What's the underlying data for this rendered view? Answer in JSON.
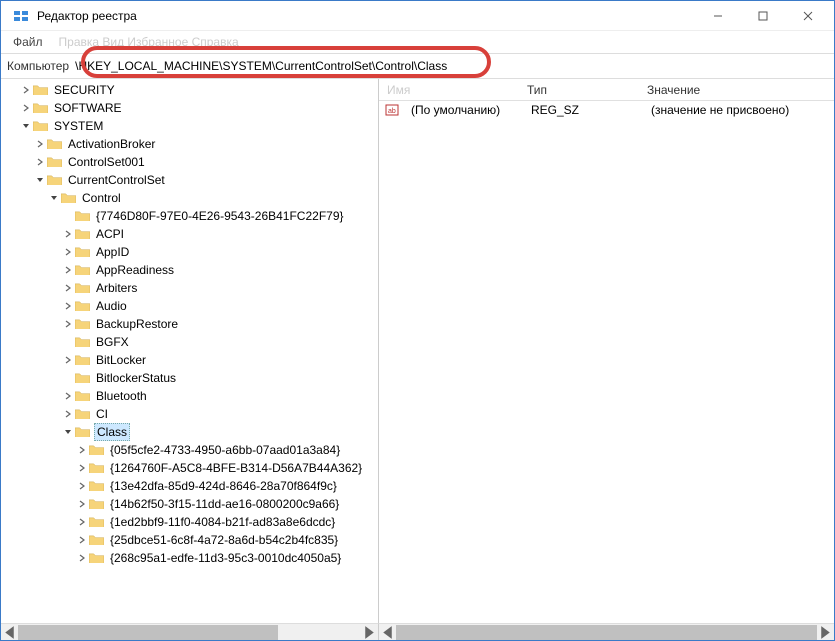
{
  "window": {
    "title": "Редактор реестра"
  },
  "menu": {
    "file": "Файл",
    "faded": "Правка   Вид   Избранное   Справка"
  },
  "addressbar": {
    "label": "Компьютер",
    "path": "\\HKEY_LOCAL_MACHINE\\SYSTEM\\CurrentControlSet\\Control\\Class"
  },
  "tree": {
    "security": "SECURITY",
    "software": "SOFTWARE",
    "system": "SYSTEM",
    "activationBroker": "ActivationBroker",
    "controlSet001": "ControlSet001",
    "currentControlSet": "CurrentControlSet",
    "control": "Control",
    "guid1": "{7746D80F-97E0-4E26-9543-26B41FC22F79}",
    "acpi": "ACPI",
    "appid": "AppID",
    "appreadiness": "AppReadiness",
    "arbiters": "Arbiters",
    "audio": "Audio",
    "backuprestore": "BackupRestore",
    "bgfx": "BGFX",
    "bitlocker": "BitLocker",
    "bitlockerstatus": "BitlockerStatus",
    "bluetooth": "Bluetooth",
    "ci": "CI",
    "class": "Class",
    "c1": "{05f5cfe2-4733-4950-a6bb-07aad01a3a84}",
    "c2": "{1264760F-A5C8-4BFE-B314-D56A7B44A362}",
    "c3": "{13e42dfa-85d9-424d-8646-28a70f864f9c}",
    "c4": "{14b62f50-3f15-11dd-ae16-0800200c9a66}",
    "c5": "{1ed2bbf9-11f0-4084-b21f-ad83a8e6dcdc}",
    "c6": "{25dbce51-6c8f-4a72-8a6d-b54c2b4fc835}",
    "c7": "{268c95a1-edfe-11d3-95c3-0010dc4050a5}"
  },
  "list": {
    "header": {
      "name": "Имя",
      "type": "Тип",
      "value": "Значение"
    },
    "row1": {
      "name": "(По умолчанию)",
      "type": "REG_SZ",
      "value": "(значение не присвоено)"
    }
  }
}
